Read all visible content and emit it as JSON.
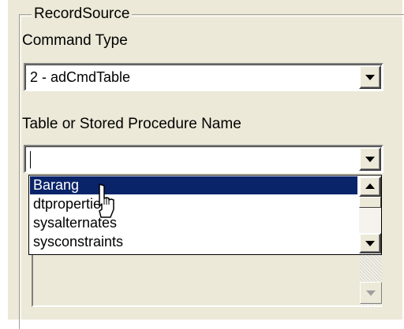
{
  "group": {
    "legend": "RecordSource"
  },
  "command_type": {
    "label": "Command Type",
    "value": "2 - adCmdTable"
  },
  "table_name": {
    "label": "Table or Stored Procedure Name",
    "value": ""
  },
  "dropdown": {
    "items": [
      "Barang",
      "dtproperties",
      "sysalternates",
      "sysconstraints"
    ],
    "selected": "Barang"
  },
  "icons": {
    "dropdown_arrow": "chevron-down-icon",
    "scroll_up": "scroll-up-icon",
    "cursor": "mouse-pointer-icon"
  },
  "colors": {
    "selection": "#0a246a",
    "panel": "#ece9d8"
  }
}
